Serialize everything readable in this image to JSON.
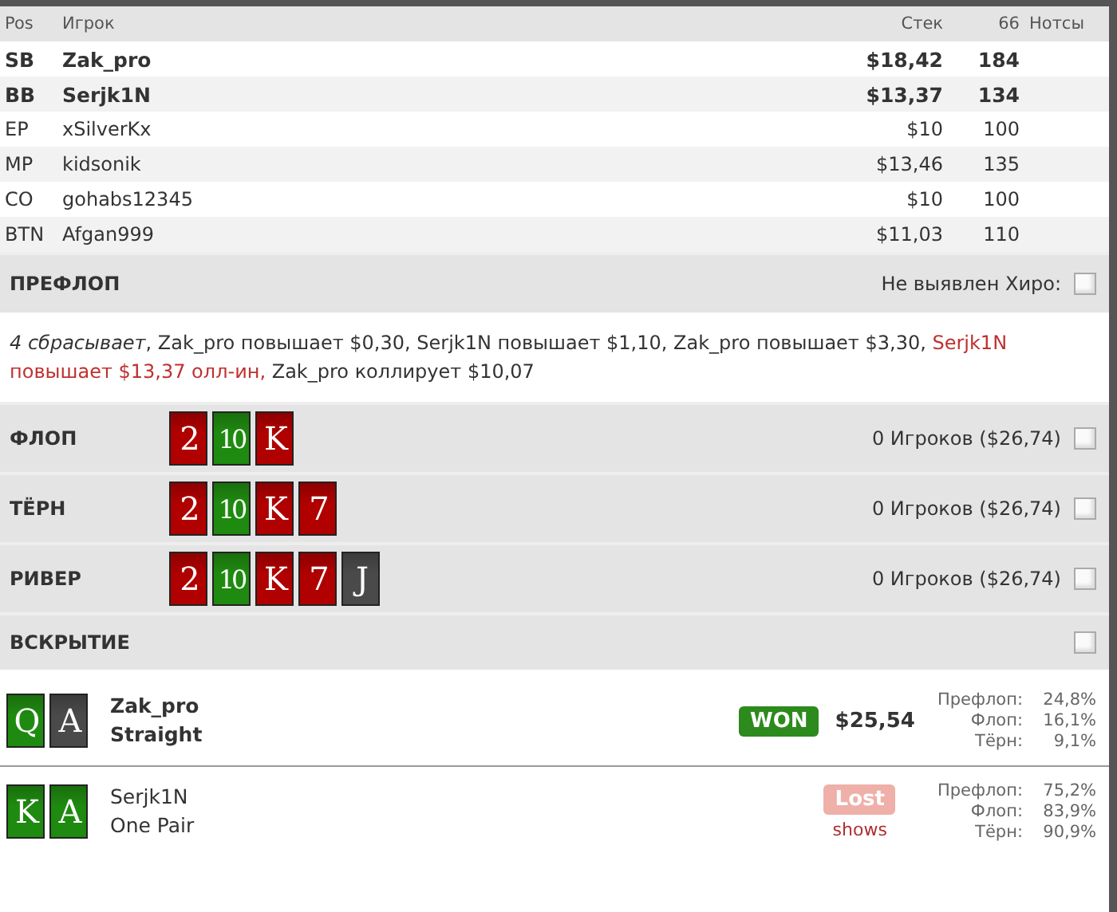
{
  "players_table": {
    "columns": [
      "Pos",
      "Игрок",
      "Стек",
      "66",
      "Нотсы"
    ],
    "rows": [
      {
        "pos": "SB",
        "name": "Zak_pro",
        "stack": "$18,42",
        "bb": "184",
        "highlighted": true
      },
      {
        "pos": "BB",
        "name": "Serjk1N",
        "stack": "$13,37",
        "bb": "134",
        "highlighted": true
      },
      {
        "pos": "EP",
        "name": "xSilverKx",
        "stack": "$10",
        "bb": "100",
        "highlighted": false
      },
      {
        "pos": "MP",
        "name": "kidsonik",
        "stack": "$13,46",
        "bb": "135",
        "highlighted": false
      },
      {
        "pos": "CO",
        "name": "gohabs12345",
        "stack": "$10",
        "bb": "100",
        "highlighted": false
      },
      {
        "pos": "BTN",
        "name": "Afgan999",
        "stack": "$11,03",
        "bb": "110",
        "highlighted": false
      }
    ]
  },
  "preflop": {
    "title": "ПРЕФЛОП",
    "hero_label": "Не выявлен Хиро:",
    "checked": false,
    "actions": [
      {
        "kind": "fold",
        "text": "4 сбрасывает"
      },
      {
        "kind": "normal",
        "text": ", Zak_pro повышает $0,30, Serjk1N повышает $1,10, Zak_pro повышает $3,30, "
      },
      {
        "kind": "allin",
        "text": "Serjk1N повышает $13,37 олл-ин,"
      },
      {
        "kind": "normal",
        "text": " Zak_pro коллирует $10,07"
      }
    ]
  },
  "streets": [
    {
      "title": "ФЛОП",
      "pot": "0 Игроков ($26,74)",
      "checked": false,
      "cards": [
        {
          "rank": "2",
          "color": "#b00000"
        },
        {
          "rank": "10",
          "color": "#1f8a10"
        },
        {
          "rank": "K",
          "color": "#b00000"
        }
      ]
    },
    {
      "title": "ТЁРН",
      "pot": "0 Игроков ($26,74)",
      "checked": false,
      "cards": [
        {
          "rank": "2",
          "color": "#b00000"
        },
        {
          "rank": "10",
          "color": "#1f8a10"
        },
        {
          "rank": "K",
          "color": "#b00000"
        },
        {
          "rank": "7",
          "color": "#b00000"
        }
      ]
    },
    {
      "title": "РИВЕР",
      "pot": "0 Игроков ($26,74)",
      "checked": false,
      "cards": [
        {
          "rank": "2",
          "color": "#b00000"
        },
        {
          "rank": "10",
          "color": "#1f8a10"
        },
        {
          "rank": "K",
          "color": "#b00000"
        },
        {
          "rank": "7",
          "color": "#b00000"
        },
        {
          "rank": "J",
          "color": "#4a4a4a"
        }
      ]
    }
  ],
  "showdown": {
    "title": "ВСКРЫТИЕ",
    "checked": false,
    "players": [
      {
        "name": "Zak_pro",
        "hand": "Straight",
        "winner": true,
        "result": {
          "kind": "won",
          "label": "WON",
          "amount": "$25,54"
        },
        "cards": [
          {
            "rank": "Q",
            "color": "#1f8a10"
          },
          {
            "rank": "A",
            "color": "#4a4a4a"
          }
        ],
        "equity": [
          {
            "label": "Префлоп:",
            "value": "24,8%"
          },
          {
            "label": "Флоп:",
            "value": "16,1%"
          },
          {
            "label": "Тёрн:",
            "value": "9,1%"
          }
        ]
      },
      {
        "name": "Serjk1N",
        "hand": "One Pair",
        "winner": false,
        "result": {
          "kind": "lost",
          "label": "Lost",
          "note": "shows"
        },
        "cards": [
          {
            "rank": "K",
            "color": "#1f8a10"
          },
          {
            "rank": "A",
            "color": "#1f8a10"
          }
        ],
        "equity": [
          {
            "label": "Префлоп:",
            "value": "75,2%"
          },
          {
            "label": "Флоп:",
            "value": "83,9%"
          },
          {
            "label": "Тёрн:",
            "value": "90,9%"
          }
        ]
      }
    ]
  }
}
